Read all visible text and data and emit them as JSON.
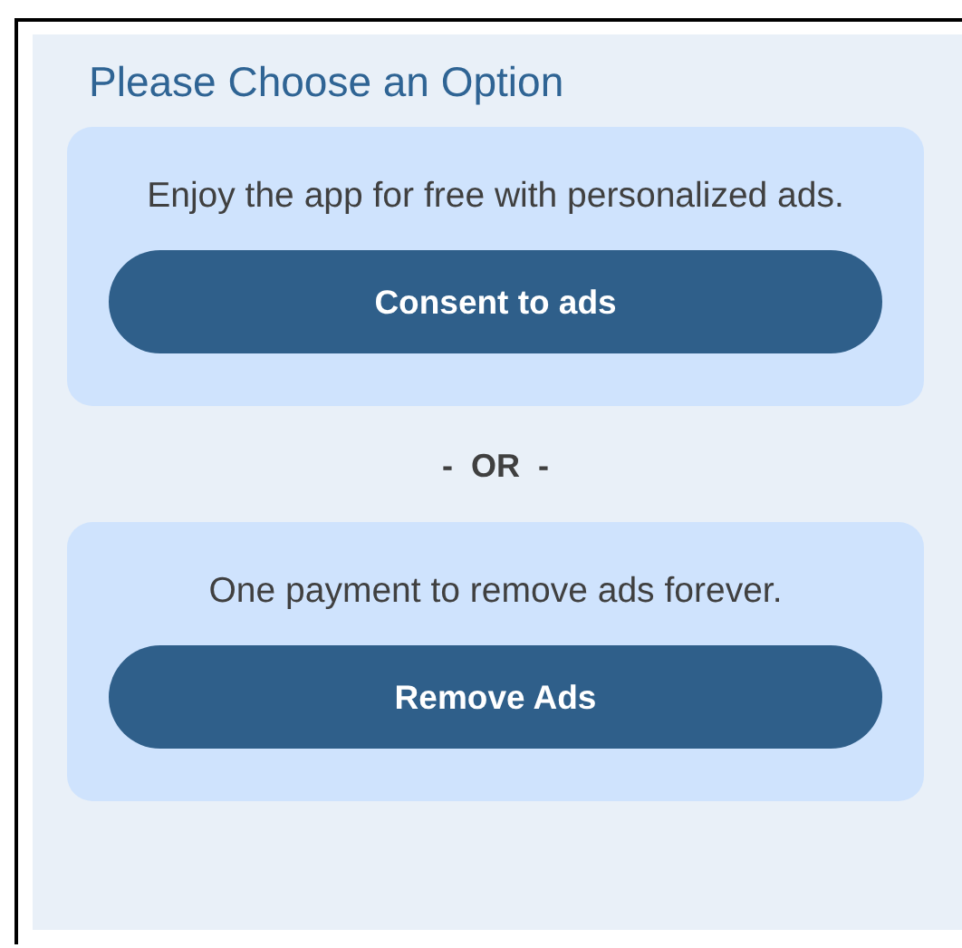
{
  "title": "Please Choose an Option",
  "options": [
    {
      "description": "Enjoy the app for free with personalized ads.",
      "button": "Consent to ads"
    },
    {
      "description": "One payment to remove ads forever.",
      "button": "Remove Ads"
    }
  ],
  "separator": "-  OR  -"
}
